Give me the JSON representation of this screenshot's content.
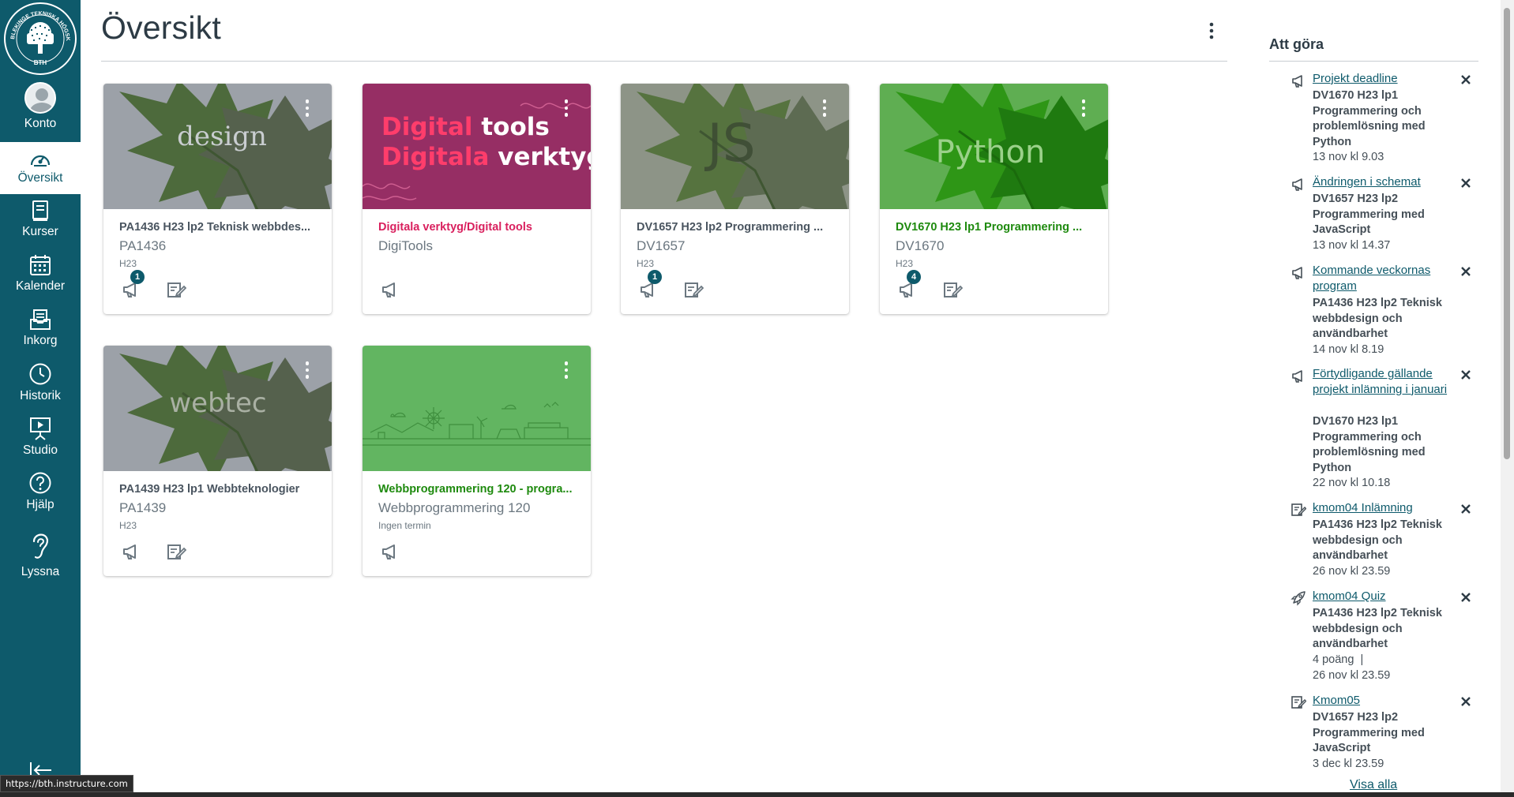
{
  "nav": {
    "logo_text": "BLEKINGE TEKNISKA HÖGSKOLA BTH",
    "items": [
      {
        "label": "Konto",
        "icon": "avatar"
      },
      {
        "label": "Översikt",
        "icon": "dashboard-icon",
        "active": true
      },
      {
        "label": "Kurser",
        "icon": "courses-icon"
      },
      {
        "label": "Kalender",
        "icon": "calendar-icon"
      },
      {
        "label": "Inkorg",
        "icon": "inbox-icon"
      },
      {
        "label": "Historik",
        "icon": "history-icon"
      },
      {
        "label": "Studio",
        "icon": "studio-icon"
      },
      {
        "label": "Hjälp",
        "icon": "help-icon"
      },
      {
        "label": "Lyssna",
        "icon": "listen-icon"
      }
    ],
    "status_url": "https://bth.instructure.com"
  },
  "page": {
    "title": "Översikt"
  },
  "cards": [
    {
      "title": "PA1436 H23 lp2 Teknisk webbdes...",
      "code": "PA1436",
      "term": "H23",
      "hero_text": "design",
      "title_color": "#4a5560",
      "announcements_badge": "1",
      "has_assignments": true
    },
    {
      "title": "Digitala verktyg/Digital tools",
      "code": "DigiTools",
      "term": "",
      "hero_text_line1_a": "Digital",
      "hero_text_line1_b": "tools",
      "hero_text_line2_a": "Digitala",
      "hero_text_line2_b": "verktyg",
      "title_color": "#d9205e",
      "announcements_badge": "",
      "has_assignments": false
    },
    {
      "title": "DV1657 H23 lp2 Programmering ...",
      "code": "DV1657",
      "term": "H23",
      "hero_text": "JS",
      "title_color": "#4a5560",
      "announcements_badge": "1",
      "has_assignments": true
    },
    {
      "title": "DV1670 H23 lp1 Programmering ...",
      "code": "DV1670",
      "term": "H23",
      "hero_text": "Python",
      "title_color": "#1e8a0e",
      "announcements_badge": "4",
      "has_assignments": true
    },
    {
      "title": "PA1439 H23 lp1 Webbteknologier",
      "code": "PA1439",
      "term": "H23",
      "hero_text": "webtec",
      "title_color": "#4a5560",
      "announcements_badge": "",
      "has_assignments": true
    },
    {
      "title": "Webbprogrammering 120 - progra...",
      "code": "Webbprogrammering 120",
      "term": "Ingen termin",
      "title_color": "#1e8a0e",
      "announcements_badge": "",
      "has_assignments": false
    }
  ],
  "todo": {
    "heading": "Att göra",
    "items": [
      {
        "type": "announcement-icon",
        "link": "Projekt deadline",
        "course": "DV1670 H23 lp1 Programmering och problemlösning med Python",
        "meta": "",
        "date": "13 nov kl 9.03"
      },
      {
        "type": "announcement-icon",
        "link": "Ändringen i schemat",
        "course": "DV1657 H23 lp2 Programmering med JavaScript",
        "meta": "",
        "date": "13 nov kl 14.37"
      },
      {
        "type": "announcement-icon",
        "link": "Kommande veckornas program",
        "course": "PA1436 H23 lp2 Teknisk webbdesign och användbarhet",
        "meta": "",
        "date": "14 nov kl 8.19"
      },
      {
        "type": "announcement-icon",
        "link": "Förtydligande gällande projekt inlämning i januari",
        "course": "DV1670 H23 lp1 Programmering och problemlösning med Python",
        "meta": "",
        "date": "22 nov kl 10.18"
      },
      {
        "type": "assignment-icon",
        "link": "kmom04 Inlämning",
        "course": "PA1436 H23 lp2 Teknisk webbdesign och användbarhet",
        "meta": "",
        "date": "26 nov kl 23.59"
      },
      {
        "type": "quiz-icon",
        "link": "kmom04 Quiz",
        "course": "PA1436 H23 lp2 Teknisk webbdesign och användbarhet",
        "meta": "4 poäng  |",
        "date": "26 nov kl 23.59"
      },
      {
        "type": "assignment-icon",
        "link": "Kmom05",
        "course": "DV1657 H23 lp2 Programmering med JavaScript",
        "meta": "",
        "date": "3 dec kl 23.59"
      }
    ],
    "show_all": "Visa alla"
  },
  "colors": {
    "nav_bg": "#0e5a6b",
    "link": "#0e5a6b",
    "badge": "#0e5a6b"
  }
}
